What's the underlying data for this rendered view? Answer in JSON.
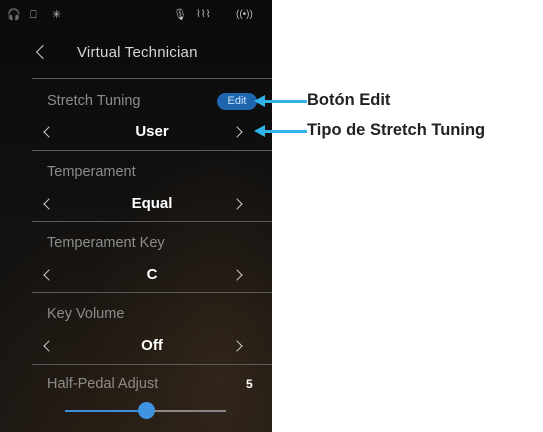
{
  "status_bar": {
    "icons": [
      "headphones-icon",
      "usb-icon",
      "bluetooth-icon",
      "microphone-icon",
      "audio-waveform-icon",
      "wireless-icon"
    ]
  },
  "nav": {
    "title": "Virtual Technician"
  },
  "settings": [
    {
      "label": "Stretch Tuning",
      "value": "User",
      "edit_label": "Edit"
    },
    {
      "label": "Temperament",
      "value": "Equal"
    },
    {
      "label": "Temperament Key",
      "value": "C"
    },
    {
      "label": "Key Volume",
      "value": "Off"
    }
  ],
  "half_pedal": {
    "label": "Half-Pedal Adjust",
    "value": "5",
    "level_fraction": 0.5
  },
  "callouts": {
    "edit": "Botón Edit",
    "stretch_type": "Tipo de Stretch Tuning"
  },
  "colors": {
    "accent": "#2fb3e8",
    "button": "#1f66b0",
    "slider": "#3f93e0"
  }
}
